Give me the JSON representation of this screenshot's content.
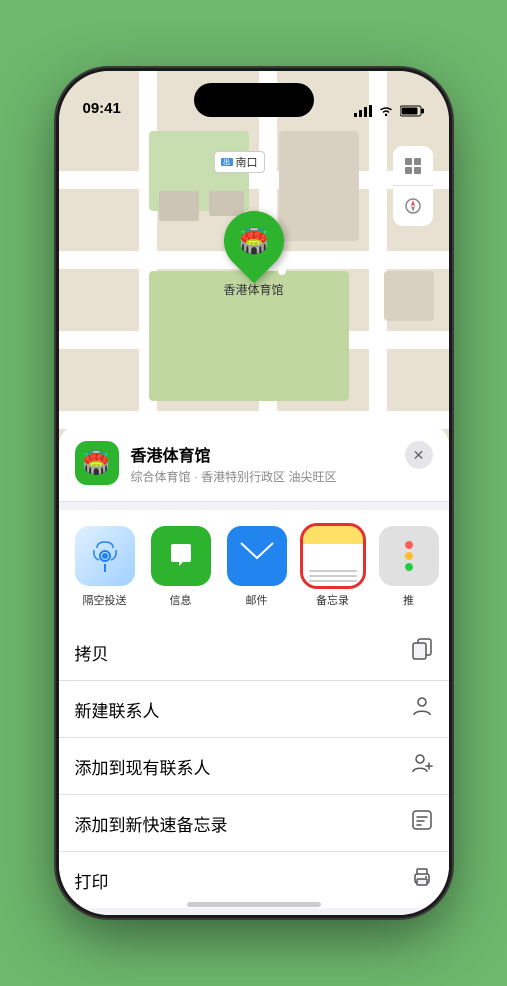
{
  "phone": {
    "time": "09:41",
    "status_icons": [
      "signal",
      "wifi",
      "battery"
    ]
  },
  "map": {
    "label": "南口",
    "controls": [
      "map-type",
      "location"
    ]
  },
  "venue": {
    "name": "香港体育馆",
    "subtitle": "综合体育馆 · 香港特别行政区 油尖旺区",
    "icon": "🏟️",
    "close_label": "×"
  },
  "share_items": [
    {
      "id": "airdrop",
      "label": "隔空投送",
      "type": "airdrop"
    },
    {
      "id": "message",
      "label": "信息",
      "type": "message"
    },
    {
      "id": "mail",
      "label": "邮件",
      "type": "mail"
    },
    {
      "id": "notes",
      "label": "备忘录",
      "type": "notes"
    },
    {
      "id": "more",
      "label": "推",
      "type": "more"
    }
  ],
  "actions": [
    {
      "id": "copy",
      "label": "拷贝",
      "icon": "copy"
    },
    {
      "id": "new-contact",
      "label": "新建联系人",
      "icon": "person"
    },
    {
      "id": "add-existing",
      "label": "添加到现有联系人",
      "icon": "person-plus"
    },
    {
      "id": "add-notes",
      "label": "添加到新快速备忘录",
      "icon": "note"
    },
    {
      "id": "print",
      "label": "打印",
      "icon": "printer"
    }
  ]
}
